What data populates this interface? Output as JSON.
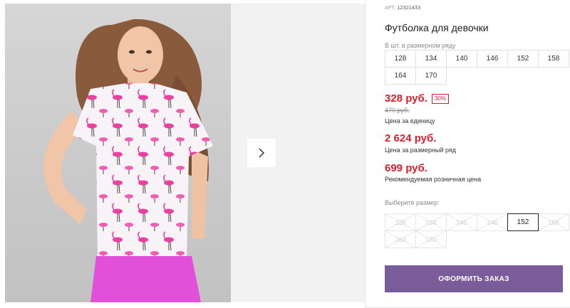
{
  "product": {
    "article_label": "АРТ.",
    "article_value": "12321433",
    "title": "Футболка для девочки"
  },
  "size_range": {
    "label": "В шт. в размерном ряду",
    "sizes": [
      "128",
      "134",
      "140",
      "146",
      "152",
      "158",
      "164",
      "170"
    ]
  },
  "prices": {
    "unit_price": "328 руб.",
    "discount": "30%",
    "old_price": "470 руб.",
    "unit_caption": "Цена за единицу",
    "range_price": "2 624 руб.",
    "range_caption": "Цена за размерный ряд",
    "retail_price": "699 руб.",
    "retail_caption": "Рекомендуемая розничная цена"
  },
  "size_picker": {
    "label": "Выберите размер:",
    "options": [
      {
        "label": "128",
        "available": false
      },
      {
        "label": "134",
        "available": false
      },
      {
        "label": "140",
        "available": false
      },
      {
        "label": "146",
        "available": false
      },
      {
        "label": "152",
        "available": true,
        "selected": true
      },
      {
        "label": "158",
        "available": false
      },
      {
        "label": "164",
        "available": false
      },
      {
        "label": "170",
        "available": false
      }
    ]
  },
  "order_button": "ОФОРМИТЬ ЗАКАЗ",
  "colors": {
    "price_red": "#d8202e",
    "button_purple": "#7a5c9b",
    "shirt_pink": "#ec3fa0",
    "shorts_pink": "#e24fd8"
  },
  "icons": {
    "next": "chevron-right-icon"
  }
}
